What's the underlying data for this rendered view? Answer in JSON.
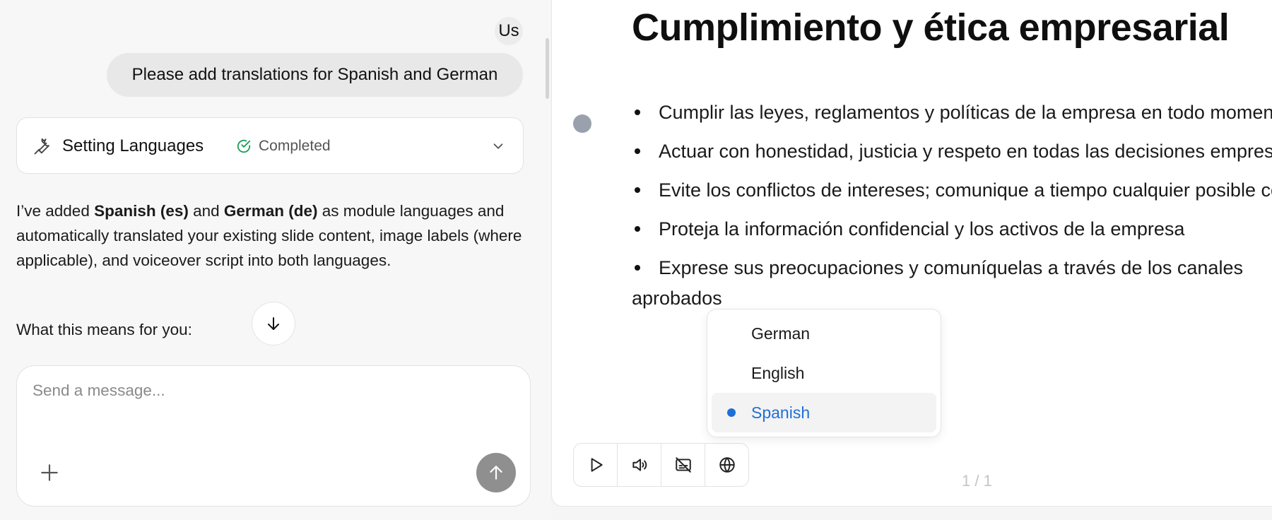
{
  "chat": {
    "avatar": "Us",
    "user_message": "Please add translations for Spanish and German",
    "tool": {
      "title": "Setting Languages",
      "status": "Completed"
    },
    "assistant": {
      "intro": "I’ve added ",
      "lang1": "Spanish (es)",
      "and": " and ",
      "lang2": "German (de)",
      "rest": " as module languages and automatically translated your existing slide content, image labels (where applicable), and voiceover script into both languages.",
      "means": "What this means for you:"
    },
    "composer": {
      "placeholder": "Send a message..."
    }
  },
  "slide": {
    "title": "Cumplimiento y ética empresarial",
    "bullets": [
      "Cumplir las leyes, reglamentos y políticas de la empresa en todo momento",
      "Actuar con honestidad, justicia y respeto en todas las decisiones empresariales",
      "Evite los conflictos de intereses; comunique a tiempo cualquier posible conflicto",
      "Proteja la información confidencial y los activos de la empresa",
      "Exprese sus preocupaciones y comuníquelas a través de los canales aprobados"
    ],
    "page_indicator": "1 / 1"
  },
  "language_menu": {
    "options": [
      "German",
      "English",
      "Spanish"
    ],
    "selected": "Spanish"
  },
  "icons": {
    "tool": "wrench-icon",
    "status": "check-circle-icon",
    "expand": "chevron-down-icon",
    "scroll": "arrow-down-icon",
    "attach": "plus-icon",
    "send": "arrow-up-icon",
    "play": "play-icon",
    "voice": "speaker-icon",
    "captions": "captions-off-icon",
    "language": "globe-icon"
  },
  "colors": {
    "accent": "#1f6fd6",
    "success": "#1e9e5a",
    "send_button": "#8f8f8f"
  }
}
